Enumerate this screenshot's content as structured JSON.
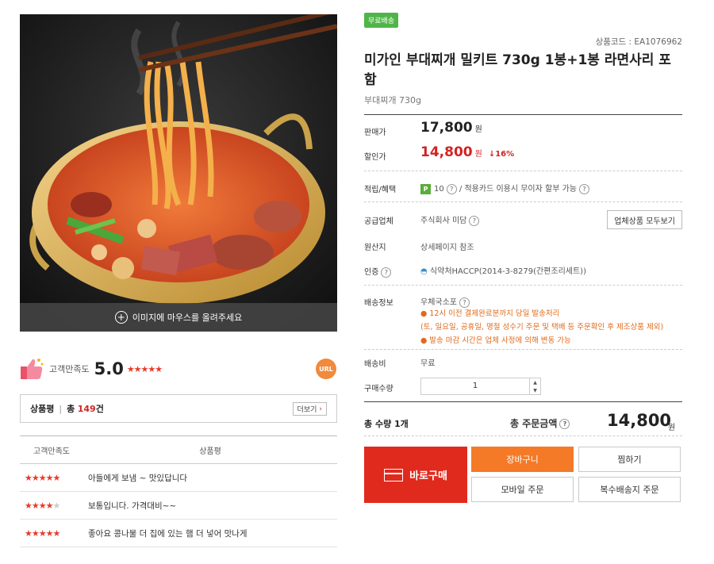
{
  "product_image": {
    "hover_hint": "이미지에 마우스를 올려주세요"
  },
  "satisfaction": {
    "label": "고객만족도",
    "score": "5.0",
    "stars": "★★★★★",
    "url_badge": "URL"
  },
  "review_summary": {
    "label": "상품평",
    "total_prefix": "총",
    "count": "149",
    "suffix": "건",
    "more_label": "더보기"
  },
  "review_table": {
    "headers": [
      "고객만족도",
      "상품평"
    ],
    "rows": [
      {
        "rating": 5,
        "text": "아들에게 보냄 ~ 맛있답니다"
      },
      {
        "rating": 4,
        "text": "보통입니다. 가격대비~~"
      },
      {
        "rating": 5,
        "text": "좋아요 콩나물 더 집에 있는 햄 더 넣어 맛나게"
      }
    ]
  },
  "product": {
    "free_shipping_badge": "무료배송",
    "code": "상품코드 : EA1076962",
    "title": "미가인 부대찌개 밀키트 730g 1봉+1봉 라면사리 포함",
    "subtitle": "부대찌개 730g"
  },
  "pricing": {
    "sale_label": "판매가",
    "sale_price": "17,800",
    "sale_unit": "원",
    "discount_label": "할인가",
    "discount_price": "14,800",
    "discount_unit": "원",
    "discount_rate": "↓16%"
  },
  "points": {
    "label": "적립/혜택",
    "badge": "P",
    "value": "10",
    "card_text": "/ 적용카드 이용시 무이자 할부 가능"
  },
  "vendor": {
    "label": "공급업체",
    "value": "주식회사 미담",
    "button": "업체상품 모두보기"
  },
  "origin": {
    "label": "원산지",
    "value": "상세페이지 참조"
  },
  "certification": {
    "label": "인증",
    "value": "식약처HACCP(2014-3-8279(간편조리세트))"
  },
  "shipping": {
    "label": "배송정보",
    "method": "우체국소포",
    "notes": [
      "● 12시 이전 결제완료분까지 당일 발송처리",
      "(토, 일요일, 공휴일, 명절 성수기 주문 및 택배 등 주문확인 후 제조상품 제외)",
      "● 발송 마감 시간은 업체 사정에 의해 변동 가능"
    ],
    "fee_label": "배송비",
    "fee_value": "무료"
  },
  "quantity": {
    "label": "구매수량",
    "value": "1"
  },
  "totals": {
    "count_label": "총 수량 1개",
    "amount_label": "총 주문금액",
    "amount": "14,800",
    "unit": "원"
  },
  "actions": {
    "buy_now": "바로구매",
    "cart": "장바구니",
    "wishlist": "찜하기",
    "mobile_order": "모바일 주문",
    "multi_ship": "복수배송지 주문"
  },
  "colors": {
    "accent_red": "#e02a1d",
    "cart_orange": "#f47a28",
    "free_badge_green": "#4fb548"
  }
}
